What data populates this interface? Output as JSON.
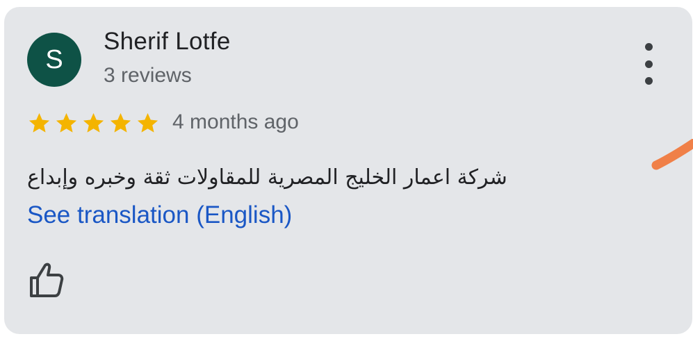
{
  "review": {
    "author": {
      "initial": "S",
      "name": "Sherif Lotfe",
      "reviews_count": "3 reviews",
      "avatar_color": "#0e5246"
    },
    "rating": 5,
    "rating_max": 5,
    "time_ago": "4 months ago",
    "text": "شركة اعمار الخليج المصرية للمقاولات ثقة وخبره وإبداع",
    "translate_link": "See translation (English)",
    "menu_icon": "more-vert-icon",
    "like_icon": "thumb-up-outline-icon"
  },
  "colors": {
    "star": "#f4b400",
    "link": "#1a57c5",
    "card_bg": "#e4e6e9",
    "annotation": "#f08048"
  }
}
